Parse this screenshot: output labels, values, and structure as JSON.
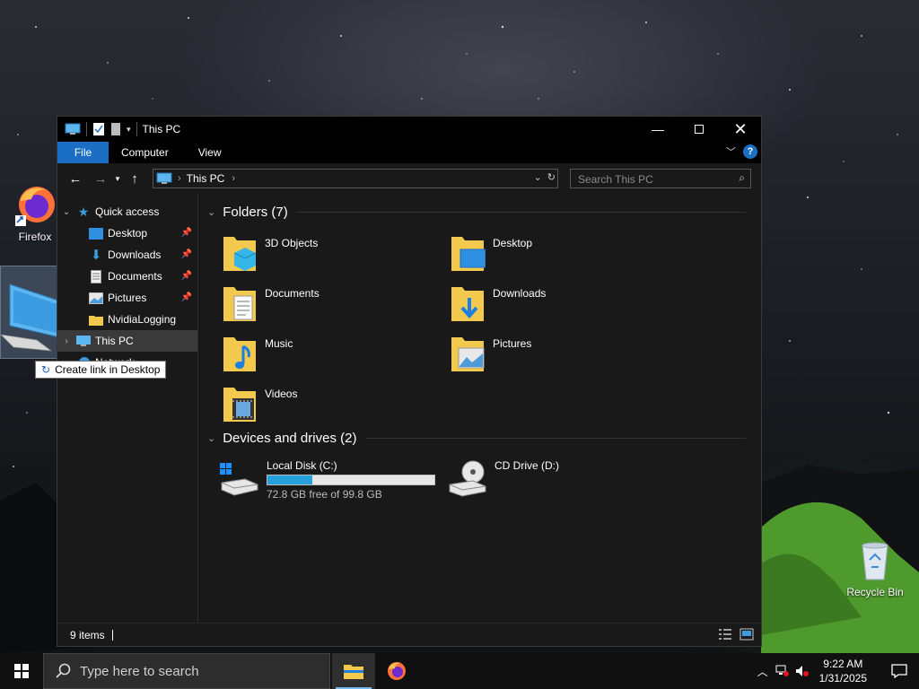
{
  "desktop": {
    "icons": [
      {
        "label": "Firefox"
      },
      {
        "label": "Recycle Bin"
      }
    ],
    "drag_tooltip": "Create link in Desktop"
  },
  "window": {
    "title": "This PC",
    "ribbon_tabs": [
      "File",
      "Computer",
      "View"
    ],
    "address": {
      "crumb": "This PC"
    },
    "search_placeholder": "Search This PC",
    "nav": {
      "quick_access": "Quick access",
      "pinned": [
        "Desktop",
        "Downloads",
        "Documents",
        "Pictures"
      ],
      "unpinned": [
        "NvidiaLogging"
      ],
      "this_pc": "This PC",
      "network": "Network"
    },
    "folders_header": "Folders (7)",
    "folders": [
      "3D Objects",
      "Desktop",
      "Documents",
      "Downloads",
      "Music",
      "Pictures",
      "Videos"
    ],
    "drives_header": "Devices and drives (2)",
    "drives": [
      {
        "name": "Local Disk (C:)",
        "free_text": "72.8 GB free of 99.8 GB",
        "used_fraction": 0.27
      },
      {
        "name": "CD Drive (D:)"
      }
    ],
    "status": "9 items"
  },
  "taskbar": {
    "search_placeholder": "Type here to search",
    "time": "9:22 AM",
    "date": "1/31/2025"
  }
}
